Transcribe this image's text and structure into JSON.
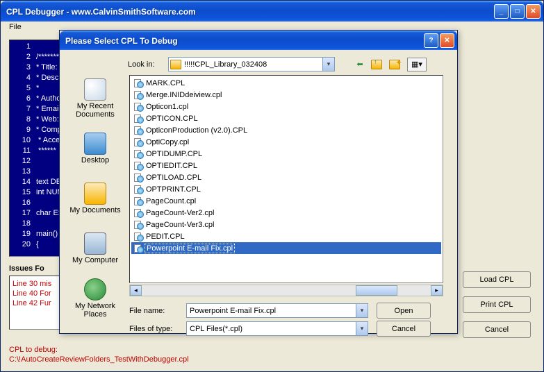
{
  "main_window": {
    "title": "CPL Debugger - www.CalvinSmithSoftware.com",
    "menu": {
      "file": "File"
    },
    "code_lines": [
      "",
      "/*******",
      "* Title:",
      "* Descrip",
      "*",
      "* Author",
      "* Email:",
      "* Web:",
      "* Compil",
      " * Accep",
      " ******",
      "",
      "",
      "text DEF",
      "int NUME",
      "",
      "char ESC",
      "",
      "main()",
      "{"
    ],
    "issues_label": "Issues Fo",
    "issues": [
      "Line 30 mis",
      "Line 40 For",
      "Line 42 Fur"
    ],
    "buttons": {
      "load": "Load CPL",
      "print": "Print CPL",
      "cancel": "Cancel"
    },
    "status_label": "CPL to debug:",
    "status_path": "C:\\!AutoCreateReviewFolders_TestWithDebugger.cpl"
  },
  "dialog": {
    "title": "Please Select CPL To Debug",
    "lookin_label": "Look in:",
    "lookin_value": "!!!!!CPL_Library_032408",
    "places": [
      {
        "label": "My Recent Documents"
      },
      {
        "label": "Desktop"
      },
      {
        "label": "My Documents"
      },
      {
        "label": "My Computer"
      },
      {
        "label": "My Network Places"
      }
    ],
    "files": [
      "MARK.CPL",
      "Merge.INIDdeiview.cpl",
      "Opticon1.cpl",
      "OPTICON.CPL",
      "OpticonProduction (v2.0).CPL",
      "OptiCopy.cpl",
      "OPTIDUMP.CPL",
      "OPTIEDIT.CPL",
      "OPTILOAD.CPL",
      "OPTPRINT.CPL",
      "PageCount.cpl",
      "PageCount-Ver2.cpl",
      "PageCount-Ver3.cpl",
      "PEDIT.CPL",
      "Powerpoint E-mail Fix.cpl"
    ],
    "selected_index": 14,
    "filename_label": "File name:",
    "filename_value": "Powerpoint E-mail Fix.cpl",
    "filetype_label": "Files of type:",
    "filetype_value": "CPL Files(*.cpl)",
    "open_btn": "Open",
    "cancel_btn": "Cancel"
  }
}
